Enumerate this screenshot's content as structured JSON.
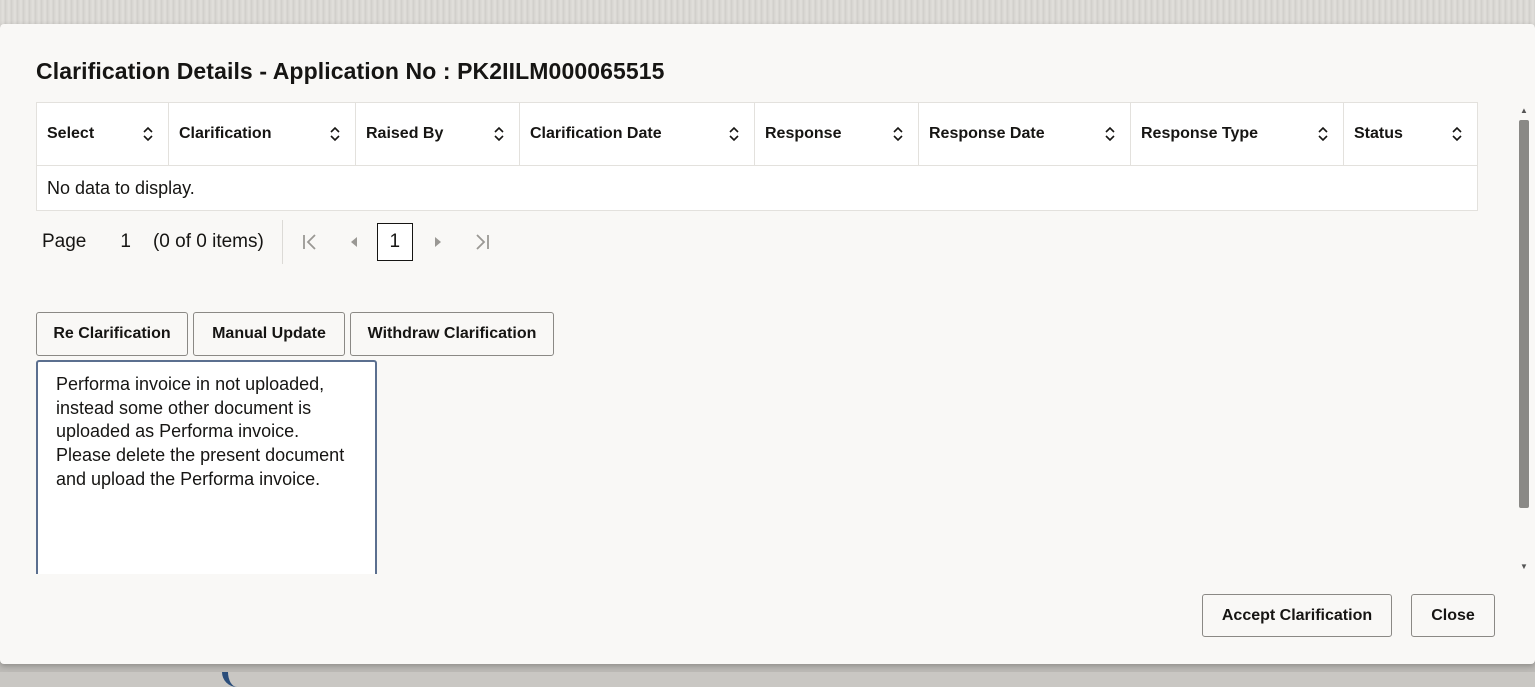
{
  "dialog": {
    "title": "Clarification Details - Application No : PK2IILM000065515"
  },
  "grid": {
    "columns": [
      {
        "label": "Select"
      },
      {
        "label": "Clarification"
      },
      {
        "label": "Raised By"
      },
      {
        "label": "Clarification Date"
      },
      {
        "label": "Response"
      },
      {
        "label": "Response Date"
      },
      {
        "label": "Response Type"
      },
      {
        "label": "Status"
      }
    ],
    "empty_message": "No data to display."
  },
  "pagination": {
    "page_label": "Page",
    "page_number": "1",
    "items_summary": "(0 of 0 items)",
    "current_page": "1"
  },
  "actions": {
    "re_clarification": "Re Clarification",
    "manual_update": "Manual Update",
    "withdraw_clarification": "Withdraw Clarification"
  },
  "remarks": {
    "value": "Performa invoice in not uploaded, instead some other document is uploaded as Performa invoice. Please delete the present document and upload the Performa invoice."
  },
  "footer": {
    "accept_label": "Accept Clarification",
    "close_label": "Close"
  },
  "icons": {
    "sort": "sort-icon",
    "first": "first-page-icon",
    "prev": "prev-page-icon",
    "next": "next-page-icon",
    "last": "last-page-icon"
  },
  "colors": {
    "dialog_bg": "#f9f8f6",
    "text": "#161513",
    "focus_border": "#5b6f8f"
  }
}
